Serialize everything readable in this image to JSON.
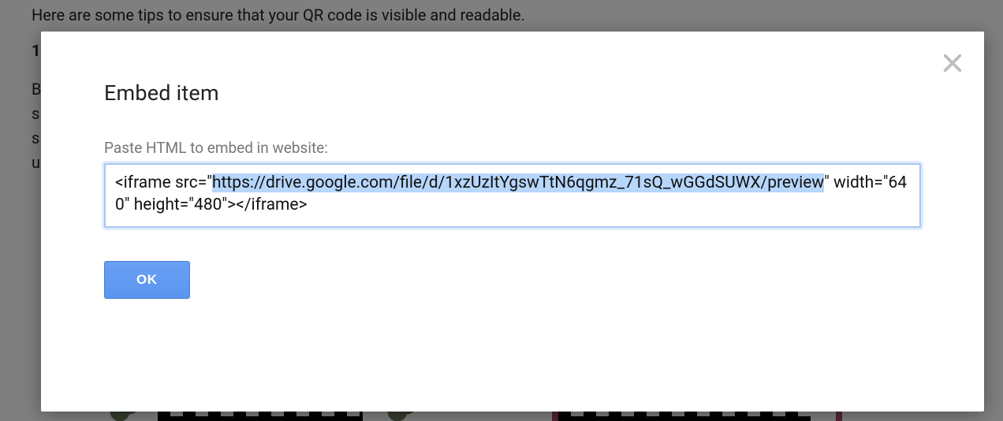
{
  "background": {
    "intro": "Here are some tips to ensure that your QR code is visible and readable.",
    "heading_prefix": "1",
    "body": "B\ns\ns\nu"
  },
  "modal": {
    "title": "Embed item",
    "field_label": "Paste HTML to embed in website:",
    "embed_code": {
      "pre": "<iframe src=\"",
      "url": "https://drive.google.com/file/d/1xzUzItYgswTtN6qgmz_71sQ_wGGdSUWX/preview",
      "post": "\" width=\"640\" height=\"480\"></iframe>"
    },
    "ok_label": "OK",
    "close_label": "Close"
  }
}
